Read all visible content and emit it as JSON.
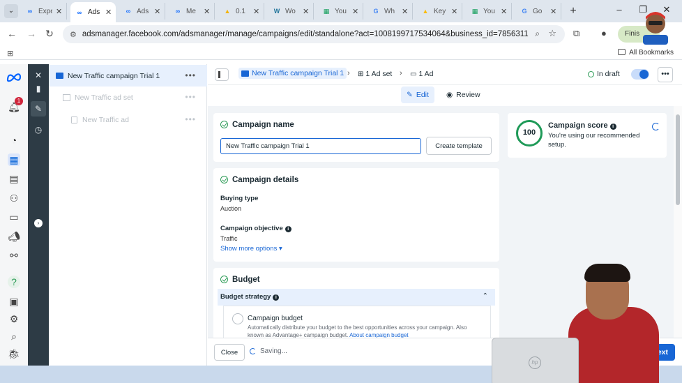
{
  "browser": {
    "tabs": [
      {
        "title": "Expe",
        "favicon": "meta",
        "color": "#0866ff"
      },
      {
        "title": "Ads",
        "favicon": "meta",
        "color": "#0866ff",
        "active": true
      },
      {
        "title": "Ads",
        "favicon": "meta",
        "color": "#0866ff"
      },
      {
        "title": "Me",
        "favicon": "meta",
        "color": "#0866ff"
      },
      {
        "title": "0.1",
        "favicon": "drive",
        "color": "#f4b400"
      },
      {
        "title": "Wo",
        "favicon": "wordpress",
        "color": "#21759b"
      },
      {
        "title": "You",
        "favicon": "sheets",
        "color": "#0f9d58"
      },
      {
        "title": "Wh",
        "favicon": "google",
        "color": "#4285f4"
      },
      {
        "title": "Key",
        "favicon": "ads",
        "color": "#fbbc04"
      },
      {
        "title": "You",
        "favicon": "sheets",
        "color": "#0f9d58"
      },
      {
        "title": "Go",
        "favicon": "google",
        "color": "#4285f4"
      }
    ],
    "url": "adsmanager.facebook.com/adsmanager/manage/campaigns/edit/standalone?act=1008199717534064&business_id=785631137036...",
    "profile_label": "Finis",
    "all_bookmarks": "All Bookmarks"
  },
  "rail": {
    "notification_count": "1"
  },
  "tree": {
    "campaign": "New Traffic campaign Trial 1",
    "ad_set": "New Traffic ad set",
    "ad": "New Traffic ad",
    "more": "•••"
  },
  "header": {
    "breadcrumb_campaign": "New Traffic campaign Trial 1",
    "breadcrumb_adset": "1 Ad set",
    "breadcrumb_ad": "1 Ad",
    "status": "In draft",
    "toggle_on": true,
    "more": "•••"
  },
  "modes": {
    "edit": "Edit",
    "review": "Review"
  },
  "campaign_name": {
    "title": "Campaign name",
    "value": "New Traffic campaign Trial 1",
    "create_template": "Create template"
  },
  "campaign_details": {
    "title": "Campaign details",
    "buying_type_label": "Buying type",
    "buying_type_value": "Auction",
    "objective_label": "Campaign objective",
    "objective_value": "Traffic",
    "show_more": "Show more options ▾"
  },
  "budget": {
    "title": "Budget",
    "strategy_label": "Budget strategy",
    "campaign_budget_label": "Campaign budget",
    "campaign_budget_desc_1": "Automatically distribute your budget to the best opportunities across your campaign. Also",
    "campaign_budget_desc_2": "known as Advantage+ campaign budget.",
    "about_link": "About campaign budget"
  },
  "score": {
    "value": "100",
    "title": "Campaign score",
    "desc_1": "You're using our recommended",
    "desc_2": "setup."
  },
  "footer": {
    "close": "Close",
    "saving": "Saving...",
    "next": "Next"
  },
  "colors": {
    "accent": "#1866d5",
    "success": "#2c9b56",
    "dark_rail": "#2d3b45"
  }
}
